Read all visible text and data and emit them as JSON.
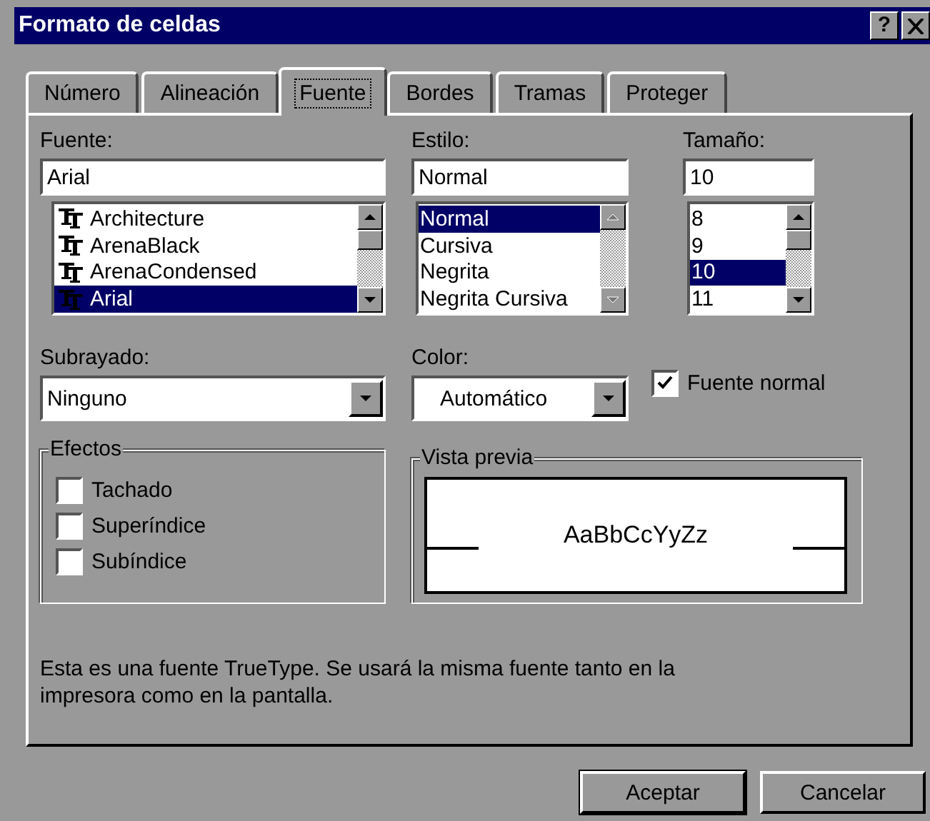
{
  "window": {
    "title": "Formato de celdas",
    "help_button": "?"
  },
  "tabs": [
    {
      "label": "Número",
      "selected": false
    },
    {
      "label": "Alineación",
      "selected": false
    },
    {
      "label": "Fuente",
      "selected": true
    },
    {
      "label": "Bordes",
      "selected": false
    },
    {
      "label": "Tramas",
      "selected": false
    },
    {
      "label": "Proteger",
      "selected": false
    }
  ],
  "font": {
    "label": "Fuente:",
    "value": "Arial",
    "items": [
      {
        "label": "Architecture",
        "selected": false
      },
      {
        "label": "ArenaBlack",
        "selected": false
      },
      {
        "label": "ArenaCondensed",
        "selected": false
      },
      {
        "label": "Arial",
        "selected": true
      }
    ]
  },
  "style": {
    "label": "Estilo:",
    "value": "Normal",
    "items": [
      {
        "label": "Normal",
        "selected": true
      },
      {
        "label": "Cursiva",
        "selected": false
      },
      {
        "label": "Negrita",
        "selected": false
      },
      {
        "label": "Negrita Cursiva",
        "selected": false
      }
    ]
  },
  "size": {
    "label": "Tamaño:",
    "value": "10",
    "items": [
      {
        "label": "8",
        "selected": false
      },
      {
        "label": "9",
        "selected": false
      },
      {
        "label": "10",
        "selected": true
      },
      {
        "label": "11",
        "selected": false
      }
    ]
  },
  "underline": {
    "label": "Subrayado:",
    "value": "Ninguno"
  },
  "color": {
    "label": "Color:",
    "value": "Automático"
  },
  "normal_font": {
    "label": "Fuente normal",
    "checked": true
  },
  "effects": {
    "title": "Efectos",
    "items": [
      {
        "label": "Tachado",
        "checked": false
      },
      {
        "label": "Superíndice",
        "checked": false
      },
      {
        "label": "Subíndice",
        "checked": false
      }
    ]
  },
  "preview": {
    "title": "Vista previa",
    "sample": "AaBbCcYyZz"
  },
  "message": "Esta es una fuente TrueType. Se usará la misma fuente tanto en la impresora como en la pantalla.",
  "buttons": [
    {
      "label": "Aceptar",
      "default": true
    },
    {
      "label": "Cancelar",
      "default": false
    }
  ]
}
